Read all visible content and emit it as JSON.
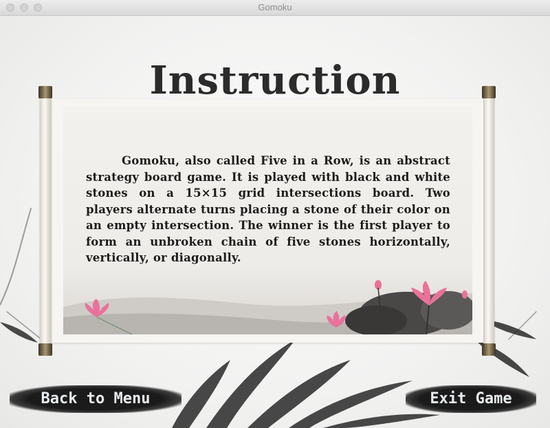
{
  "window": {
    "title": "Gomoku"
  },
  "heading": "Instruction",
  "instructions": "Gomoku, also called Five in a Row, is an abstract strategy board game. It is played with black and white stones on a 15×15 grid intersections board. Two players alternate turns placing a stone of their color on an empty intersection. The winner is the first player to form an unbroken chain of five stones horizontally, vertically, or diagonally.",
  "buttons": {
    "back": "Back to Menu",
    "exit": "Exit Game"
  },
  "colors": {
    "ink": "#1b1b1b",
    "lotus": "#e9729a",
    "paper": "#f3f1ed"
  }
}
